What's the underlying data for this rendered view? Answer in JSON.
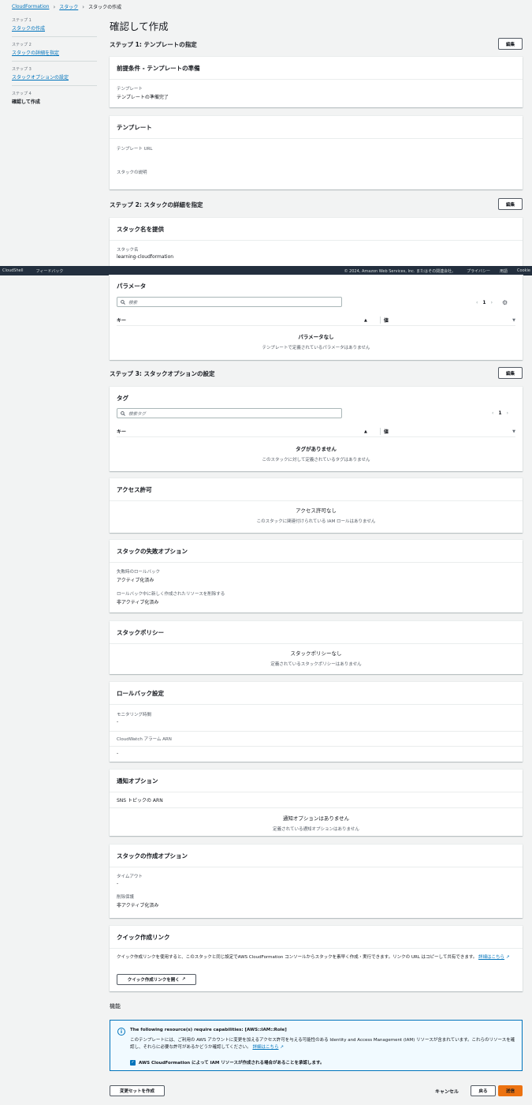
{
  "breadcrumb": {
    "items": [
      "CloudFormation",
      "スタック",
      "スタックの作成"
    ]
  },
  "sidebar": {
    "steps": [
      {
        "step": "ステップ 1",
        "label": "スタックの作成"
      },
      {
        "step": "ステップ 2",
        "label": "スタックの詳細を指定"
      },
      {
        "step": "ステップ 3",
        "label": "スタックオプションの設定"
      },
      {
        "step": "ステップ 4",
        "label": "確認して作成"
      }
    ]
  },
  "page": {
    "title": "確認して作成"
  },
  "edit_label": "編集",
  "step1": {
    "title": "ステップ 1: テンプレートの指定",
    "prereq": {
      "title": "前提条件 - テンプレートの準備",
      "field_label": "テンプレート",
      "field_value": "テンプレートの準備完了"
    },
    "template": {
      "title": "テンプレート",
      "url_label": "テンプレート URL",
      "desc_label": "スタックの説明"
    }
  },
  "step2": {
    "title": "ステップ 2: スタックの詳細を指定",
    "stackname": {
      "title": "スタック名を提供",
      "label": "スタック名",
      "value": "learning-cloudformation"
    },
    "params": {
      "title": "パラメータ",
      "search_placeholder": "検索",
      "page": "1",
      "col_key": "キー",
      "col_value": "値",
      "empty_title": "パラメータなし",
      "empty_sub": "テンプレートで定義されているパラメータはありません"
    }
  },
  "footer": {
    "cloudshell": "CloudShell",
    "feedback": "フィードバック",
    "copyright": "© 2024, Amazon Web Services, Inc. またはその関連会社。",
    "privacy": "プライバシー",
    "terms": "用語",
    "cookie": "Cookie"
  },
  "step3": {
    "title": "ステップ 3: スタックオプションの設定",
    "tags": {
      "title": "タグ",
      "search_placeholder": "検索タグ",
      "page": "1",
      "col_key": "キー",
      "col_value": "値",
      "empty_title": "タグがありません",
      "empty_sub": "このスタックに対して定義されているタグはありません"
    },
    "perm": {
      "title": "アクセス許可",
      "empty_title": "アクセス許可なし",
      "empty_sub": "このスタックに関連付けられている IAM ロールはありません"
    },
    "failure": {
      "title": "スタックの失敗オプション",
      "f1_label": "失敗時のロールバック",
      "f1_value": "アクティブ化済み",
      "f2_label": "ロールバック中に新しく作成されたリソースを削除する",
      "f2_value": "非アクティブ化済み"
    },
    "policy": {
      "title": "スタックポリシー",
      "empty_title": "スタックポリシーなし",
      "empty_sub": "定義されているスタックポリシーはありません"
    },
    "rollback": {
      "title": "ロールバック設定",
      "f1_label": "モニタリング時間",
      "f1_value": "-",
      "f2_label": "CloudWatch アラーム ARN",
      "f2_value": "-"
    },
    "notify": {
      "title": "通知オプション",
      "col": "SNS トピックの ARN",
      "empty_title": "通知オプションはありません",
      "empty_sub": "定義されている通知オプションはありません"
    },
    "create": {
      "title": "スタックの作成オプション",
      "f1_label": "タイムアウト",
      "f1_value": "-",
      "f2_label": "削除保護",
      "f2_value": "非アクティブ化済み"
    }
  },
  "quick": {
    "title": "クイック作成リンク",
    "text": "クイック作成リンクを使用すると、このスタックと同じ設定でAWS CloudFormation コンソールからスタックを素早く作成・実行できます。リンクの URL はコピーして共有できます。",
    "learn": "詳細はこちら",
    "button": "クイック作成リンクを開く"
  },
  "capabilities": {
    "title": "機能",
    "warn_title": "The following resource(s) require capabilities: [AWS::IAM::Role]",
    "warn_text": "このテンプレートには、ご利用の AWS アカウントに変更を加えるアクセス許可を与える可能性のある Identity and Access Management (IAM) リソースが含まれています。これらのリソースを確認し、それらに必要な許可があるかどうか確認してください。",
    "learn": "詳細はこちら",
    "ack": "AWS CloudFormation によって IAM リソースが作成される場合があることを承認します。"
  },
  "actions": {
    "changeset": "変更セットを作成",
    "cancel": "キャンセル",
    "prev": "戻る",
    "submit": "送信"
  },
  "colors": {
    "accent": "#ec7211",
    "link": "#0073bb",
    "footer": "#232f3e"
  }
}
